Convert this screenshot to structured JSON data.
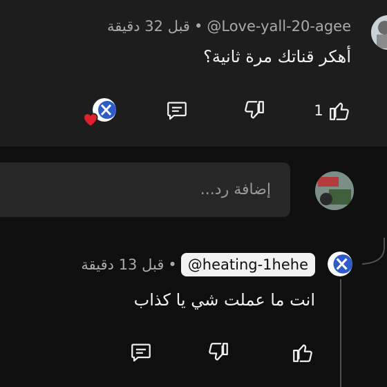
{
  "comment": {
    "author": "@Love-yall-20-agee",
    "time": "قبل 32 دقيقة",
    "separator": "•",
    "text": "أهكر قناتك مرة ثانية؟",
    "like_count": "1"
  },
  "reply_box": {
    "placeholder": "إضافة رد..."
  },
  "reply": {
    "mention": "@heating-1hehe",
    "time": "قبل 13 دقيقة",
    "separator": "•",
    "text": "انت ما عملت شي يا كذاب"
  },
  "colors": {
    "background": "#0f0f0f",
    "comment_bg": "#1d1d1d",
    "input_bg": "#272727",
    "heart": "#e0202f",
    "text_primary": "#f1f1f1",
    "text_secondary": "#aaaaaa"
  },
  "icons": [
    "like-icon",
    "dislike-icon",
    "reply-icon",
    "creator-heart-icon",
    "chevron-icon"
  ]
}
